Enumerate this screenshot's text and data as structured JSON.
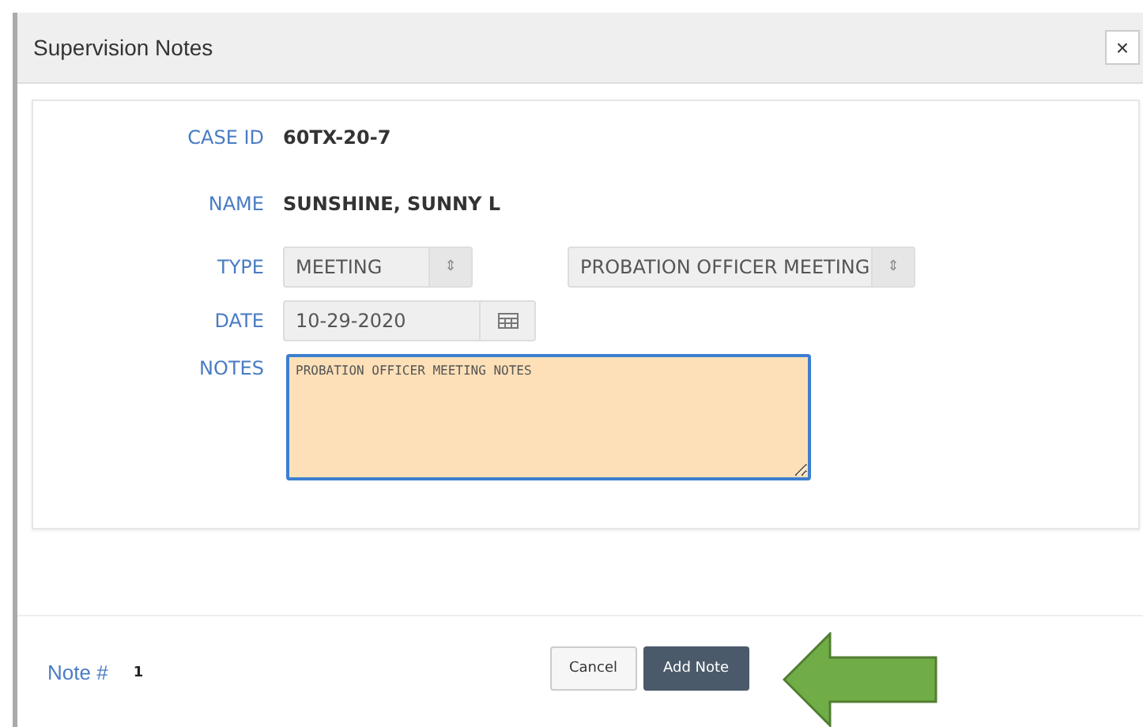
{
  "dialog": {
    "title": "Supervision Notes",
    "close": "×"
  },
  "form": {
    "case_id": {
      "label": "CASE ID",
      "value": "60TX-20-7"
    },
    "name": {
      "label": "NAME",
      "value": "SUNSHINE, SUNNY L"
    },
    "type": {
      "label": "TYPE",
      "selects": [
        {
          "value": "MEETING",
          "arrow": "⇕"
        },
        {
          "value": "PROBATION OFFICER MEETING",
          "arrow": "⇕"
        }
      ]
    },
    "date": {
      "label": "DATE",
      "value": "10-29-2020"
    },
    "notes": {
      "label": "NOTES",
      "value": "PROBATION OFFICER MEETING NOTES"
    }
  },
  "footer": {
    "note_label": "Note #",
    "note_number": "1",
    "buttons": [
      {
        "label": "Cancel",
        "kind": "secondary"
      },
      {
        "label": "Add Note",
        "kind": "primary"
      }
    ]
  }
}
